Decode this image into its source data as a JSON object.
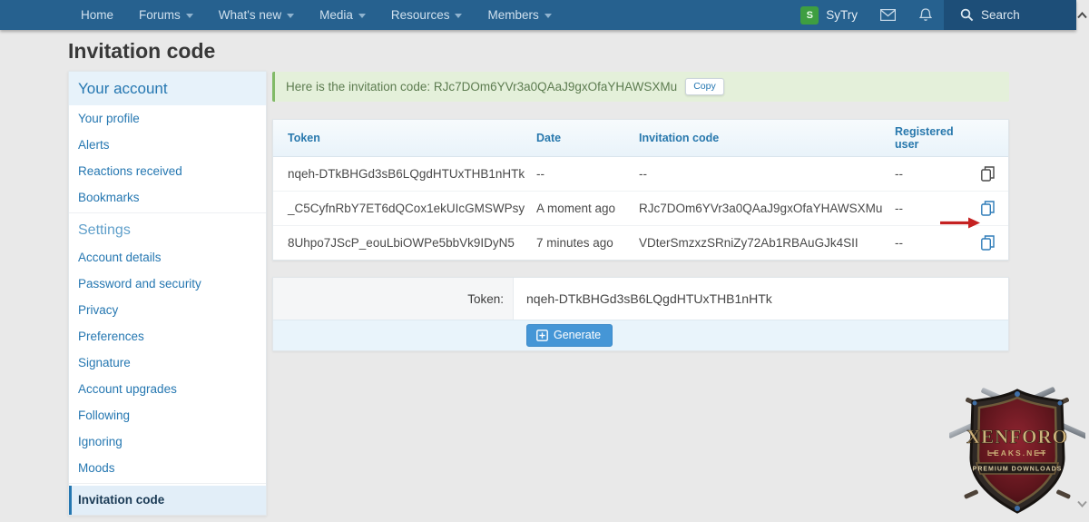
{
  "colors": {
    "accent_blue": "#2577b1",
    "nav_bg": "#26618f",
    "search_bg": "#1d4e78",
    "alert_green_bg": "#e4f0da",
    "alert_green_border": "#81ba67",
    "button_blue": "#4596d6",
    "arrow_red": "#c42121",
    "avatar_green": "#3e9e41"
  },
  "nav": {
    "items": [
      {
        "label": "Home"
      },
      {
        "label": "Forums"
      },
      {
        "label": "What's new"
      },
      {
        "label": "Media"
      },
      {
        "label": "Resources"
      },
      {
        "label": "Members"
      }
    ],
    "user": {
      "name": "SyTry",
      "avatar_letter": "S"
    },
    "search_label": "Search"
  },
  "page": {
    "title": "Invitation code"
  },
  "sidebar": {
    "header": "Your account",
    "account_items": [
      "Your profile",
      "Alerts",
      "Reactions received",
      "Bookmarks"
    ],
    "settings_header": "Settings",
    "settings_items": [
      "Account details",
      "Password and security",
      "Privacy",
      "Preferences",
      "Signature",
      "Account upgrades",
      "Following",
      "Ignoring",
      "Moods"
    ],
    "selected_item": "Invitation code"
  },
  "alert": {
    "prefix": "Here is the invitation code: ",
    "code": "RJc7DOm6YVr3a0QAaJ9gxOfaYHAWSXMu",
    "copy_label": "Copy"
  },
  "table": {
    "columns": [
      "Token",
      "Date",
      "Invitation code",
      "Registered user"
    ],
    "rows": [
      {
        "token": "nqeh-DTkBHGd3sB6LQgdHTUxTHB1nHTk",
        "date": "--",
        "invitation_code": "--",
        "registered_user": "--"
      },
      {
        "token": "_C5CyfnRbY7ET6dQCox1ekUIcGMSWPsy",
        "date": "A moment ago",
        "invitation_code": "RJc7DOm6YVr3a0QAaJ9gxOfaYHAWSXMu",
        "registered_user": "--"
      },
      {
        "token": "8Uhpo7JScP_eouLbiOWPe5bbVk9IDyN5",
        "date": "7 minutes ago",
        "invitation_code": "VDterSmzxzSRniZy72Ab1RBAuGJk4SII",
        "registered_user": "--"
      }
    ]
  },
  "form": {
    "token_label": "Token:",
    "token_value": "nqeh-DTkBHGd3sB6LQgdHTUxTHB1nHTk",
    "generate_label": "Generate"
  },
  "watermark": {
    "title": "XENFORO",
    "subtitle": "LEAKS.NET",
    "banner": "PREMIUM DOWNLOADS"
  }
}
